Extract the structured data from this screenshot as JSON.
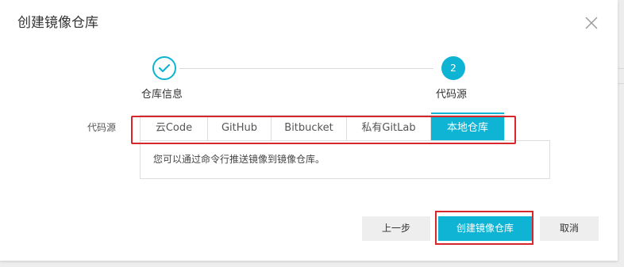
{
  "dialog": {
    "title": "创建镜像仓库"
  },
  "steps": [
    {
      "label": "仓库信息",
      "status": "done"
    },
    {
      "label": "代码源",
      "number": "2",
      "status": "active"
    }
  ],
  "source": {
    "label": "代码源",
    "tabs": [
      {
        "label": "云Code"
      },
      {
        "label": "GitHub"
      },
      {
        "label": "Bitbucket"
      },
      {
        "label": "私有GitLab"
      },
      {
        "label": "本地仓库",
        "active": true
      }
    ],
    "panel_text": "您可以通过命令行推送镜像到镜像仓库。"
  },
  "footer": {
    "prev_label": "上一步",
    "create_label": "创建镜像仓库",
    "cancel_label": "取消"
  },
  "colors": {
    "accent": "#0fb3d3",
    "highlight": "#d9262c"
  }
}
